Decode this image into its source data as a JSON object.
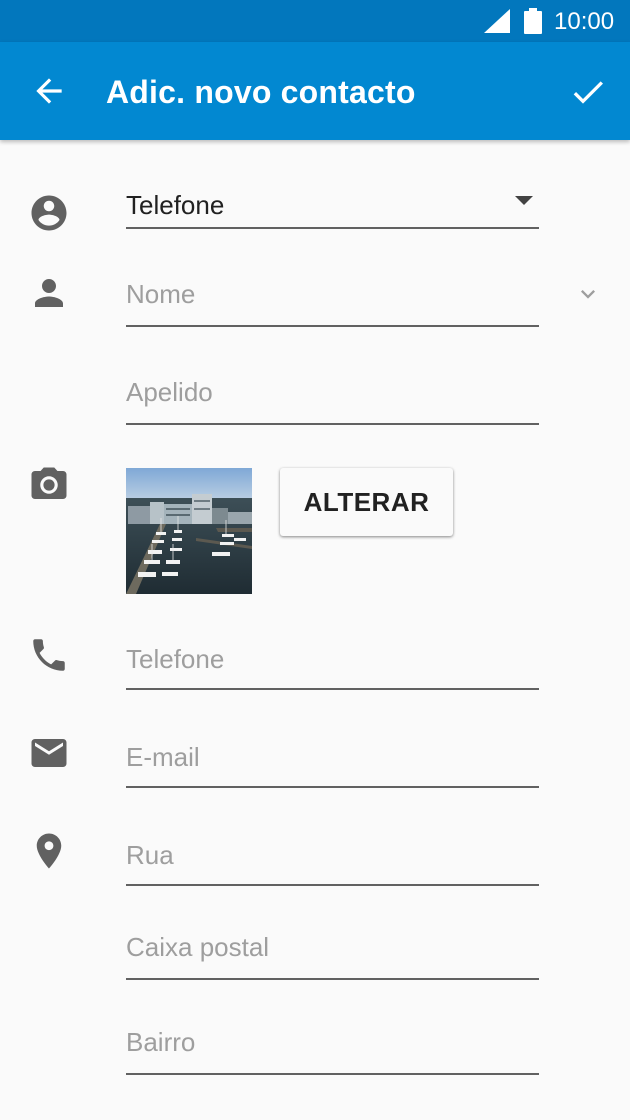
{
  "status_bar": {
    "time": "10:00",
    "icons": [
      "signal-icon",
      "battery-icon"
    ]
  },
  "app_bar": {
    "title": "Adic. novo contacto",
    "back_icon": "arrow-left-icon",
    "save_icon": "check-icon",
    "background_color": "#0288d1"
  },
  "account": {
    "icon": "account-circle-icon",
    "value": "Telefone"
  },
  "name": {
    "icon": "person-icon",
    "first_placeholder": "Nome",
    "last_placeholder": "Apelido",
    "expand_icon": "chevron-down-icon"
  },
  "photo": {
    "icon": "camera-icon",
    "button_label": "ALTERAR"
  },
  "phone": {
    "icon": "phone-icon",
    "placeholder": "Telefone"
  },
  "email": {
    "icon": "email-icon",
    "placeholder": "E-mail"
  },
  "address": {
    "icon": "location-pin-icon",
    "street_placeholder": "Rua",
    "pobox_placeholder": "Caixa postal",
    "neighborhood_placeholder": "Bairro"
  }
}
